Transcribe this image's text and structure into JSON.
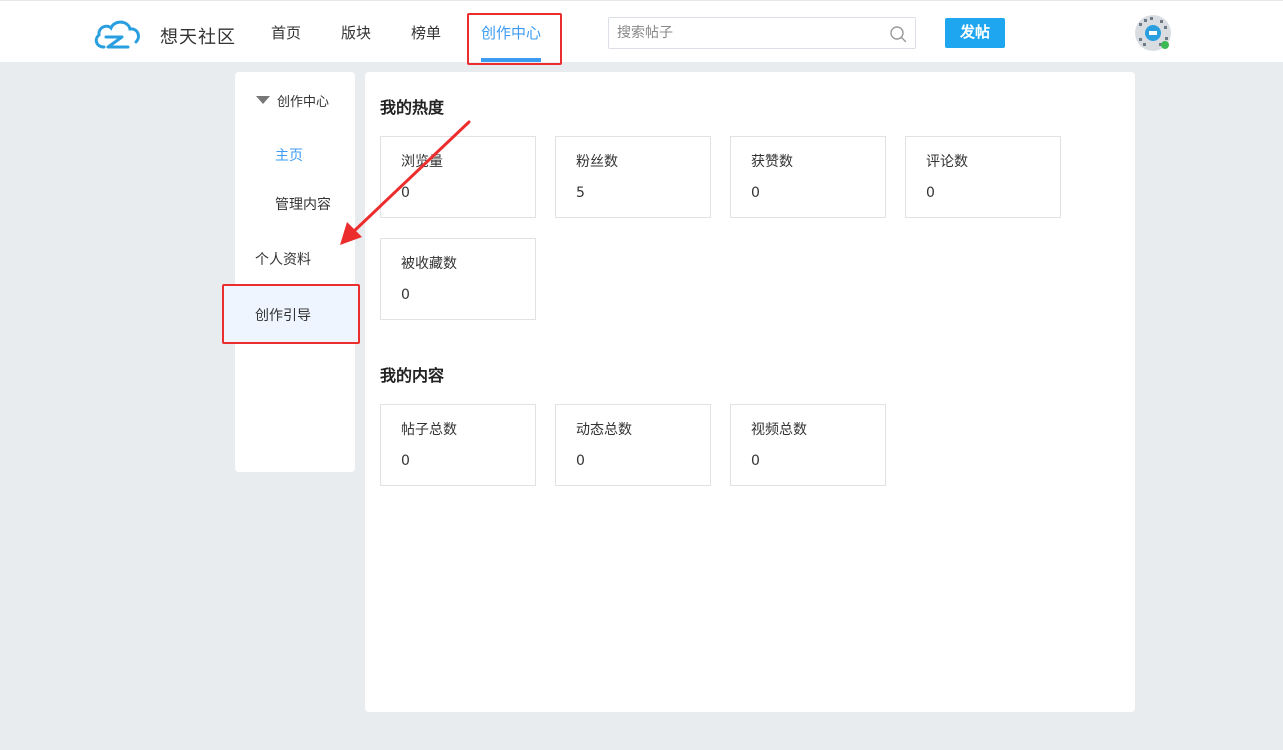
{
  "header": {
    "site_name": "想天社区",
    "nav": [
      {
        "label": "首页"
      },
      {
        "label": "版块"
      },
      {
        "label": "榜单"
      },
      {
        "label": "创作中心"
      }
    ],
    "search": {
      "placeholder": "搜索帖子",
      "value": ""
    },
    "post_button_label": "发帖"
  },
  "sidebar": {
    "group_label": "创作中心",
    "items": [
      {
        "label": "主页"
      },
      {
        "label": "管理内容"
      },
      {
        "label": "个人资料"
      },
      {
        "label": "创作引导"
      }
    ]
  },
  "main": {
    "heat": {
      "title": "我的热度",
      "stats": [
        {
          "label": "浏览量",
          "value": "0"
        },
        {
          "label": "粉丝数",
          "value": "5"
        },
        {
          "label": "获赞数",
          "value": "0"
        },
        {
          "label": "评论数",
          "value": "0"
        },
        {
          "label": "被收藏数",
          "value": "0"
        }
      ]
    },
    "content": {
      "title": "我的内容",
      "stats": [
        {
          "label": "帖子总数",
          "value": "0"
        },
        {
          "label": "动态总数",
          "value": "0"
        },
        {
          "label": "视频总数",
          "value": "0"
        }
      ]
    }
  },
  "icons": {
    "logo": "cloud-logo-icon",
    "search": "search-icon",
    "avatar": "avatar",
    "collapse": "triangle-down-icon"
  },
  "colors": {
    "accent": "#3d9bf2",
    "post_button": "#1ea6f0",
    "annotation": "#ec2d2d",
    "page_background": "#e9ecef"
  }
}
